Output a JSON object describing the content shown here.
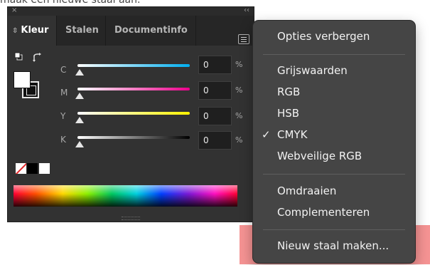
{
  "caption": "maak een nieuwe staal aan.",
  "titlebar": {
    "close_glyph": "×",
    "collapse_glyph": "‹‹"
  },
  "tabs": [
    {
      "label": "Kleur",
      "active": true
    },
    {
      "label": "Stalen",
      "active": false
    },
    {
      "label": "Documentinfo",
      "active": false
    }
  ],
  "tab_arrows_glyph": "⇳",
  "channels": [
    {
      "label": "C",
      "value": "0",
      "unit": "%",
      "color": "#00aeef"
    },
    {
      "label": "M",
      "value": "0",
      "unit": "%",
      "color": "#ec008c"
    },
    {
      "label": "Y",
      "value": "0",
      "unit": "%",
      "color": "#fff200"
    },
    {
      "label": "K",
      "value": "0",
      "unit": "%",
      "color": "#000000"
    }
  ],
  "menu": {
    "items": [
      {
        "label": "Opties verbergen"
      },
      {
        "label": "Grijswaarden"
      },
      {
        "label": "RGB"
      },
      {
        "label": "HSB"
      },
      {
        "label": "CMYK",
        "checked": true
      },
      {
        "label": "Webveilige RGB"
      },
      {
        "label": "Omdraaien"
      },
      {
        "label": "Complementeren"
      },
      {
        "label": "Nieuw staal maken..."
      }
    ],
    "check_glyph": "✓"
  },
  "colors": {
    "panel_bg": "#323232",
    "menu_bg": "#454545",
    "highlight": "#f27878"
  }
}
